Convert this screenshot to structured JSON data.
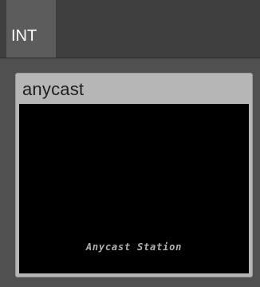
{
  "tabs": [
    {
      "label": "INT"
    }
  ],
  "station": {
    "name": "anycast",
    "screen_text": "Anycast Station"
  },
  "colors": {
    "header_background": "#3f3f3f",
    "active_tab": "#5c5c5c",
    "content_background": "#505050",
    "card_background": "#b6b6b6",
    "screen_background": "#000000",
    "screen_text": "#b0b0b0"
  }
}
